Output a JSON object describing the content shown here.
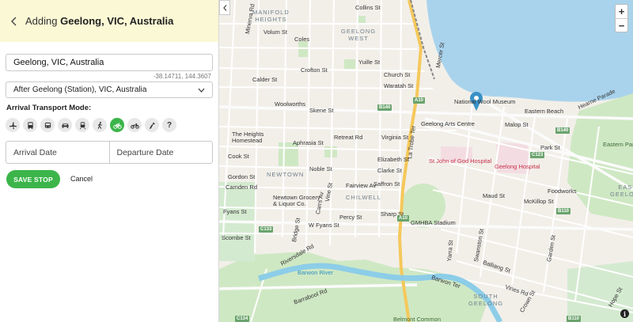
{
  "header": {
    "prefix": "Adding",
    "place": "Geelong, VIC, Australia"
  },
  "form": {
    "location_value": "Geelong, VIC, Australia",
    "coords": "-38.14711, 144.3607",
    "after_value": "After Geelong (Station), VIC, Australia",
    "transport_label": "Arrival Transport Mode:",
    "transport_modes": [
      "plane-icon",
      "bus-icon",
      "coach-icon",
      "car-icon",
      "train-icon",
      "walk-icon",
      "bicycle-icon",
      "motorbike-icon",
      "horse-icon",
      "unknown-icon"
    ],
    "selected_mode": "bicycle-icon",
    "unknown_glyph": "?",
    "arrival_placeholder": "Arrival Date",
    "departure_placeholder": "Departure Date",
    "save_label": "SAVE STOP",
    "cancel_label": "Cancel"
  },
  "map": {
    "zoom_in": "+",
    "zoom_out": "−",
    "info": "i",
    "suburbs": {
      "manifold": "MANIFOLD\nHEIGHTS",
      "geelong_west": "GEELONG\nWEST",
      "newtown": "NEWTOWN",
      "chilwell": "CHILWELL",
      "south_geelong": "SOUTH\nGEELONG",
      "east_geelong": "EAST\nGEELONG"
    },
    "streets": {
      "collins": "Collins St",
      "minerva": "Minerva Rd",
      "volum": "Volum St",
      "coles": "Coles",
      "yuille": "Yuille St",
      "crofton": "Crofton St",
      "calder": "Calder St",
      "church": "Church St",
      "waratah": "Waratah St",
      "woolworths": "Woolworths",
      "skene": "Skene St",
      "heights": "The Heights\nHomestead",
      "retreat": "Retreat Rd",
      "virginia": "Virginia St",
      "aphrasia": "Aphrasia St",
      "noble": "Noble St",
      "cook": "Cook St",
      "gordon": "Gordon St",
      "fairview": "Fairview Av",
      "elizabeth": "Elizabeth St",
      "clarke": "Clarke St",
      "saffron": "Saffron St",
      "camden": "Camden Rd",
      "newtown_grocery": "Newtown Grocery\n& Liquor Co.",
      "carrs": "Carrs Av",
      "vine": "Vine St",
      "percy": "Percy St",
      "sharp": "Sharp St",
      "fyans": "W Fyans St",
      "fyans2": "Fyans St",
      "scombe": "Scombe St",
      "riversdale": "Riversdale Rd",
      "bridge": "Bridge St",
      "barwon": "Barwon River",
      "barrabool": "Barrabool Rd",
      "belmont": "Belmont Common",
      "latrobe": "La Trobe Ter",
      "mercer": "Mercer St",
      "national": "National Wool Museum",
      "arts": "Geelong Arts Centre",
      "eastern_beach": "Eastern Beach",
      "hearne": "Hearne Parade",
      "malop": "Malop St",
      "park": "Park St",
      "eastern_park": "Eastern Park",
      "st_john": "St John of God Hospital",
      "geelong_hosp": "Geelong Hospital",
      "foodworks": "Foodworks",
      "mckillop": "McKillop St",
      "maud": "Maud St",
      "gmhba": "GMHBA Stadium",
      "yarra": "Yarra St",
      "swanston": "Swanston St",
      "barwon_ter": "Barwon Ter",
      "balliang": "Balliang St",
      "garden": "Garden St",
      "vines": "Vines Rd",
      "crown": "Crown St",
      "hope": "Hope St"
    },
    "shields": [
      "A10",
      "B140",
      "B140",
      "C123",
      "B110",
      "C133",
      "C134",
      "B110",
      "A10"
    ]
  }
}
